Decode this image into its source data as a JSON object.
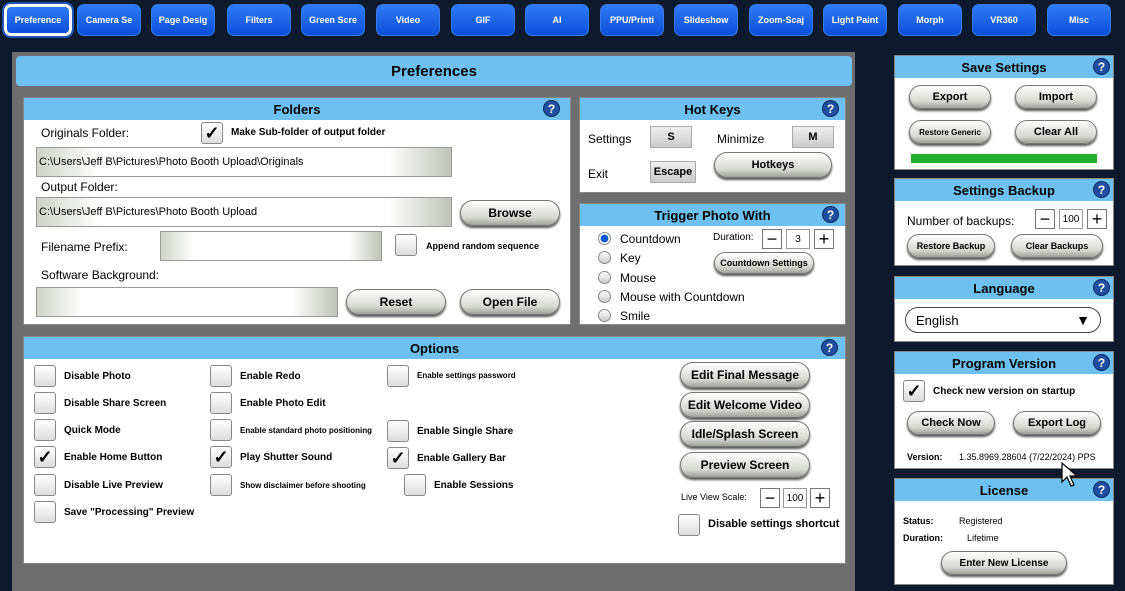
{
  "tabs": [
    "Preference",
    "Camera Se",
    "Page Desig",
    "Filters",
    "Green Scre",
    "Video",
    "GIF",
    "AI",
    "PPU/Printi",
    "Slideshow",
    "Zoom-Scaj",
    "Light Paint",
    "Morph",
    "VR360",
    "Misc"
  ],
  "main_title": "Preferences",
  "help_glyph": "?",
  "folders": {
    "title": "Folders",
    "originals_label": "Originals Folder:",
    "subfolder_label": "Make Sub-folder of output folder",
    "originals_value": "C:\\Users\\Jeff B\\Pictures\\Photo Booth Upload\\Originals",
    "output_label": "Output Folder:",
    "output_value": "C:\\Users\\Jeff B\\Pictures\\Photo Booth Upload",
    "browse": "Browse",
    "prefix_label": "Filename Prefix:",
    "prefix_value": "",
    "append_label": "Append random sequence",
    "bg_label": "Software Background:",
    "bg_value": "",
    "reset": "Reset",
    "open_file": "Open File"
  },
  "hotkeys": {
    "title": "Hot Keys",
    "settings_label": "Settings",
    "settings_key": "S",
    "minimize_label": "Minimize",
    "minimize_key": "M",
    "exit_label": "Exit",
    "exit_key": "Escape",
    "hotkeys_button": "Hotkeys"
  },
  "trigger": {
    "title": "Trigger Photo With",
    "options": [
      "Countdown",
      "Key",
      "Mouse",
      "Mouse with Countdown",
      "Smile"
    ],
    "selected": "Countdown",
    "duration_label": "Duration:",
    "duration_value": "3",
    "countdown_settings": "Countdown Settings"
  },
  "options": {
    "title": "Options",
    "col1": [
      "Disable Photo",
      "Disable Share Screen",
      "Quick Mode",
      "Enable Home Button",
      "Disable Live Preview",
      "Save \"Processing\" Preview"
    ],
    "col2": [
      "Enable Redo",
      "Enable Photo Edit",
      "Enable standard photo positioning",
      "Play Shutter Sound",
      "Show disclaimer before shooting"
    ],
    "col3": [
      "Enable settings password",
      "Enable Single Share",
      "Enable Gallery Bar",
      "Enable Sessions"
    ],
    "buttons": [
      "Edit Final Message",
      "Edit Welcome Video",
      "Idle/Splash Screen",
      "Preview Screen"
    ],
    "live_view_label": "Live View Scale:",
    "live_view_value": "100",
    "disable_shortcut": "Disable settings shortcut",
    "check_glyph": "✓",
    "minus_glyph": "−",
    "plus_glyph": "+"
  },
  "save_settings": {
    "title": "Save Settings",
    "export": "Export",
    "import": "Import",
    "restore_generic": "Restore Generic",
    "clear_all": "Clear All",
    "status_color": "#22b02a"
  },
  "backup": {
    "title": "Settings Backup",
    "number_label": "Number of backups:",
    "number_value": "100",
    "restore": "Restore Backup",
    "clear": "Clear Backups"
  },
  "language": {
    "title": "Language",
    "value": "English",
    "arrow_glyph": "▼"
  },
  "version": {
    "title": "Program Version",
    "check_label": "Check new version on startup",
    "check_now": "Check Now",
    "export_log": "Export Log",
    "version_label": "Version:",
    "version_value": "1.35.8969.28604 (7/22/2024) PPS"
  },
  "license": {
    "title": "License",
    "status_label": "Status:",
    "status_value": "Registered",
    "duration_label": "Duration:",
    "duration_value": "Lifetime",
    "enter_new": "Enter New License"
  },
  "colors": {
    "header": "#6ec0f0",
    "tab": "#1b63e8",
    "help": "#1f4f9e",
    "background": "#0d1a2e"
  }
}
